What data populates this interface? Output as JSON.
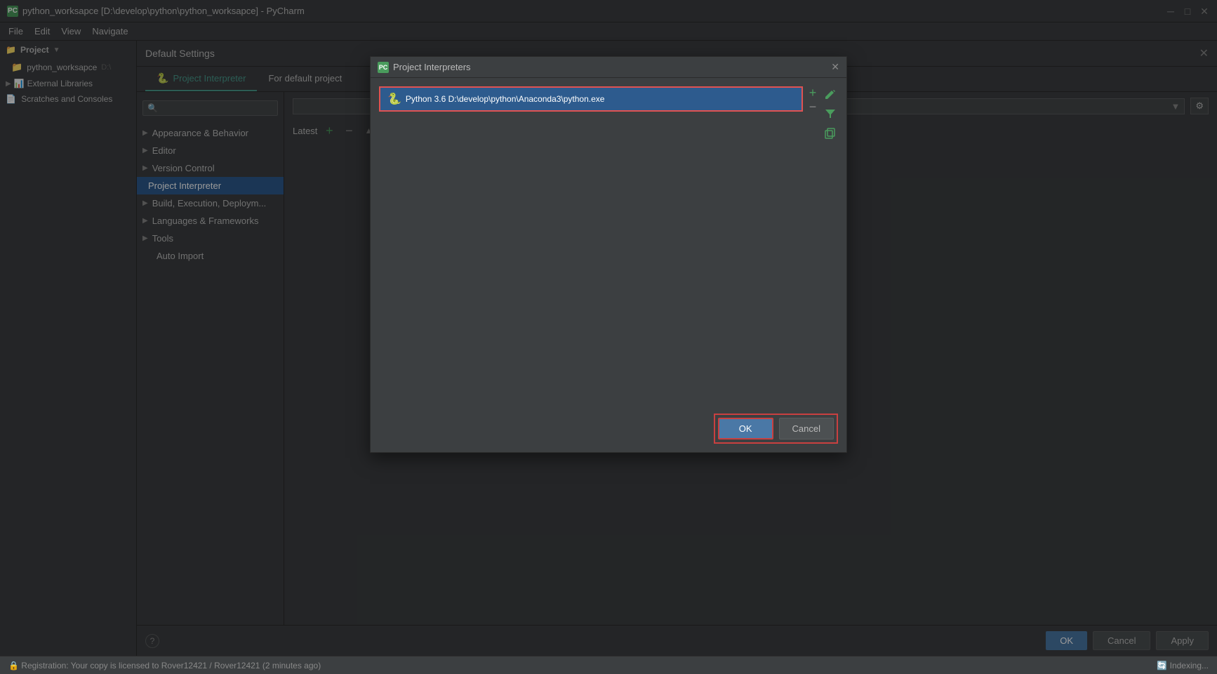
{
  "app": {
    "title": "python_worksapce [D:\\develop\\python\\python_worksapce] - PyCharm",
    "icon_label": "PC"
  },
  "title_bar": {
    "text": "python_worksapce [D:\\develop\\python\\python_worksapce] - PyCharm",
    "minimize_label": "─",
    "maximize_label": "□",
    "close_label": "✕"
  },
  "menu": {
    "items": [
      "File",
      "Edit",
      "View",
      "Navigate"
    ]
  },
  "default_settings_dialog": {
    "title": "Default Settings",
    "close_label": "✕"
  },
  "tabs": [
    {
      "id": "project-interpreter",
      "label": "Project Interpreter",
      "active": true
    },
    {
      "id": "for-default-project",
      "label": "For default project",
      "active": false
    }
  ],
  "settings_sidebar": {
    "search_placeholder": "🔍",
    "items": [
      {
        "id": "appearance",
        "label": "Appearance & Behavior",
        "has_arrow": true,
        "level": 0
      },
      {
        "id": "editor",
        "label": "Editor",
        "has_arrow": true,
        "level": 0
      },
      {
        "id": "version-control",
        "label": "Version Control",
        "has_arrow": true,
        "level": 0
      },
      {
        "id": "project-interpreter",
        "label": "Project Interpreter",
        "has_arrow": false,
        "level": 1,
        "selected": true
      },
      {
        "id": "build-execution",
        "label": "Build, Execution, Deploym...",
        "has_arrow": true,
        "level": 0
      },
      {
        "id": "languages",
        "label": "Languages & Frameworks",
        "has_arrow": true,
        "level": 0
      },
      {
        "id": "tools",
        "label": "Tools",
        "has_arrow": true,
        "level": 0
      },
      {
        "id": "auto-import",
        "label": "Auto Import",
        "has_arrow": false,
        "level": 1
      }
    ]
  },
  "right_panel": {
    "latest_label": "Latest",
    "plus_label": "+",
    "minus_label": "−",
    "up_label": "▲",
    "down_label": "▼"
  },
  "interpreters_dialog": {
    "title": "Project Interpreters",
    "icon_label": "PC",
    "close_label": "✕",
    "interpreter_path": "Python 3.6 D:\\develop\\python\\Anaconda3\\python.exe",
    "add_label": "+",
    "remove_label": "−",
    "edit_icon": "✏",
    "filter_icon": "▼",
    "copy_icon": "⧉",
    "ok_label": "OK",
    "cancel_label": "Cancel"
  },
  "footer": {
    "help_label": "?",
    "ok_label": "OK",
    "cancel_label": "Cancel",
    "apply_label": "Apply"
  },
  "sidebar_tree": {
    "project_label": "Project",
    "workspace_label": "python_worksapce",
    "workspace_path": "D:\\",
    "external_lib_label": "External Libraries",
    "scratches_label": "Scratches and Consoles"
  },
  "status_bar": {
    "left_text": "🔒 Registration: Your copy is licensed to Rover12421 / Rover12421 (2 minutes ago)",
    "right_text": "🔄 Indexing..."
  }
}
